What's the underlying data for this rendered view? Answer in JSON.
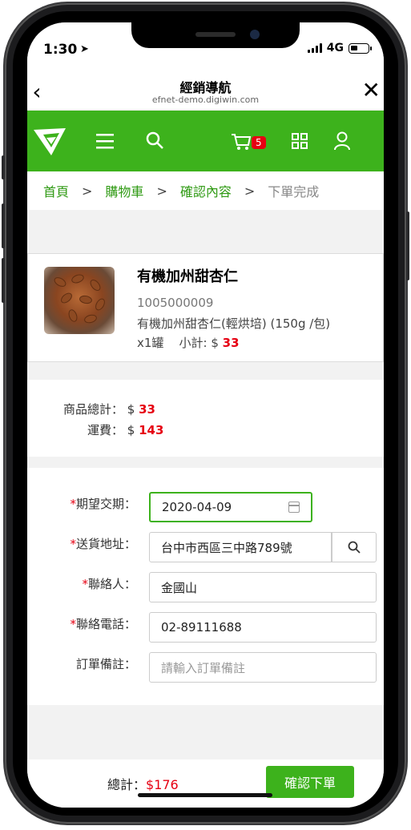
{
  "status_bar": {
    "time": "1:30",
    "network": "4G"
  },
  "nav": {
    "title": "經銷導航",
    "url": "efnet-demo.digiwin.com"
  },
  "appbar": {
    "cart_count": "5",
    "brand_color": "#3db21c"
  },
  "breadcrumb": {
    "home": "首頁",
    "cart": "購物車",
    "confirm": "確認內容",
    "done": "下單完成",
    "separator": ">"
  },
  "product": {
    "name": "有機加州甜杏仁",
    "sku": "1005000009",
    "description": "有機加州甜杏仁(輕烘培) (150g /包)",
    "quantity": "x1罐",
    "subtotal_label": "小計: $",
    "subtotal": "33"
  },
  "totals": {
    "goods_label": "商品總計：",
    "goods_currency": "$",
    "goods_amount": "33",
    "shipping_label": "運費：",
    "shipping_currency": "$",
    "shipping_amount": "143"
  },
  "form": {
    "date_label": "期望交期：",
    "date_value": "2020-04-09",
    "address_label": "送貨地址：",
    "address_value": "台中市西區三中路789號",
    "contact_label": "聯絡人：",
    "contact_value": "金國山",
    "phone_label": "聯絡電話：",
    "phone_value": "02-89111688",
    "note_label": "訂單備註：",
    "note_placeholder": "請輸入訂單備註",
    "required_mark": "*"
  },
  "footer": {
    "total_label": "總計：",
    "total_value": "$176",
    "confirm_label": "確認下單"
  }
}
